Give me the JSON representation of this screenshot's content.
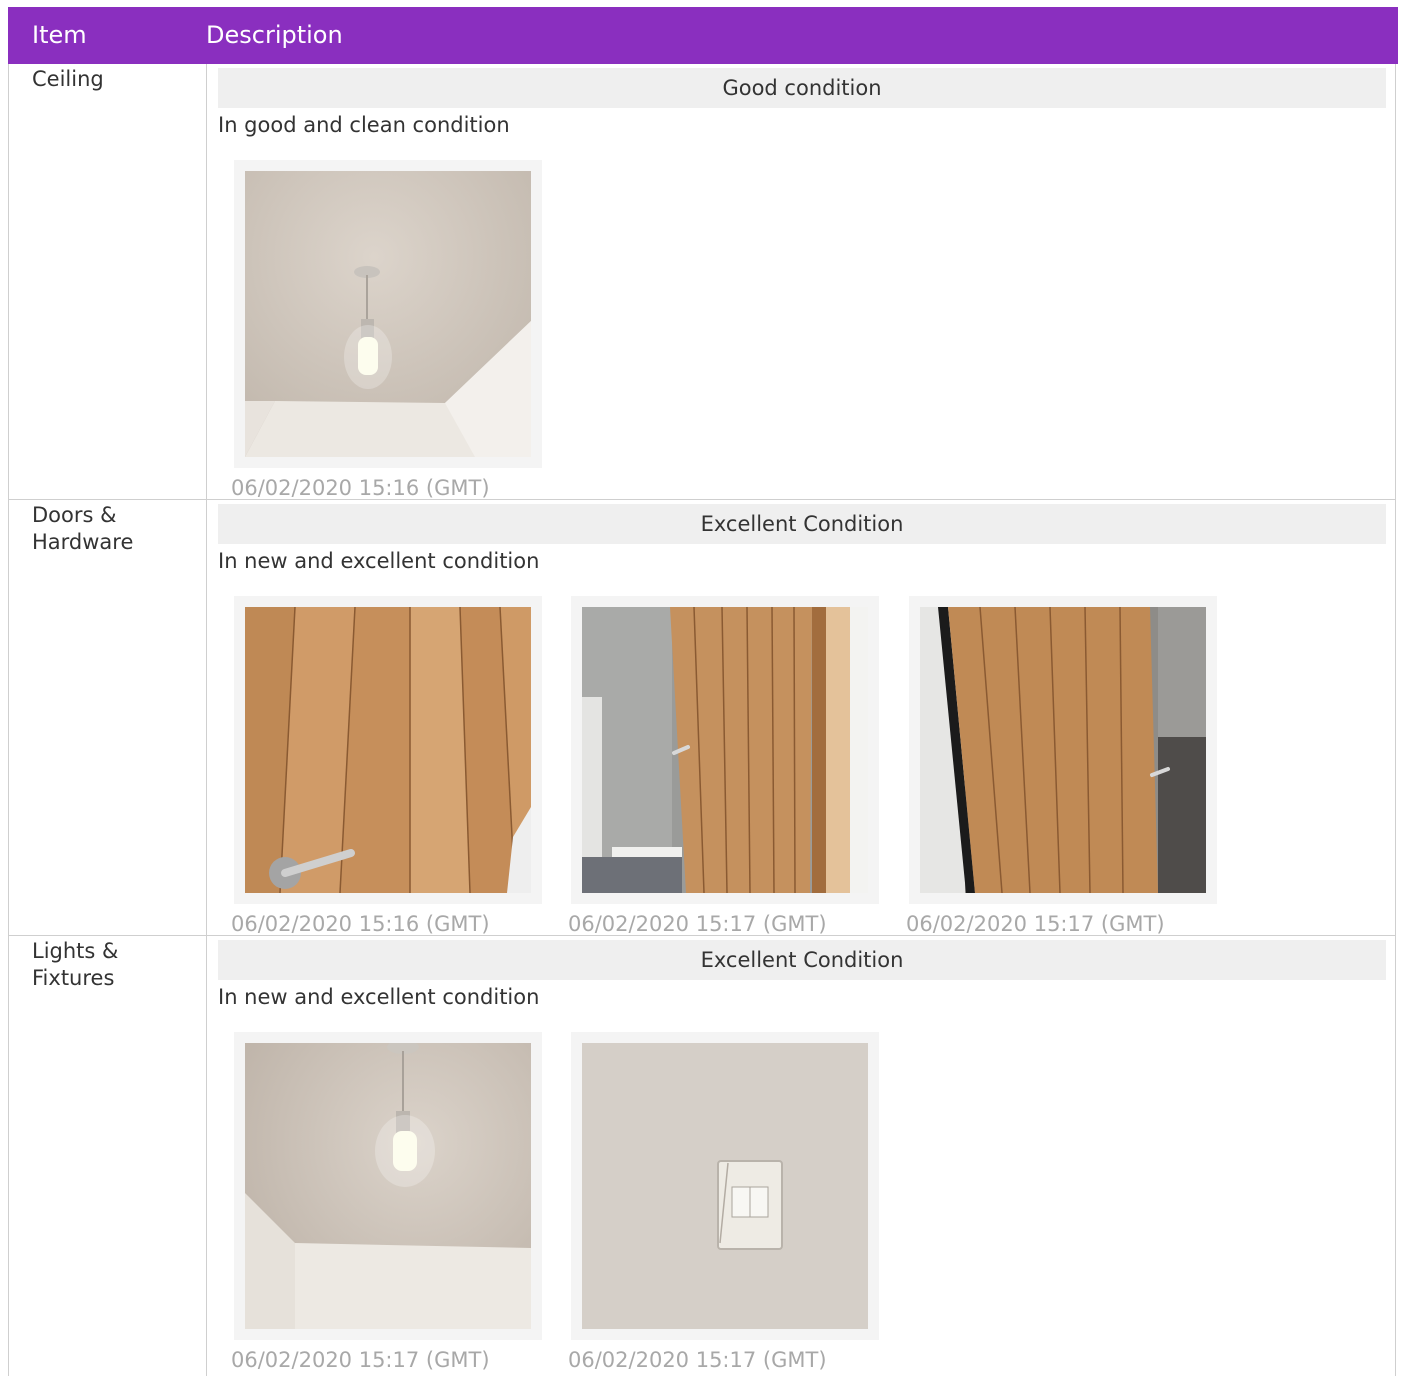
{
  "header": {
    "item": "Item",
    "description": "Description"
  },
  "rows": [
    {
      "item": "Ceiling",
      "condition": "Good condition",
      "description": "In good and clean condition",
      "photos": [
        {
          "subject": "ceiling-light-photo",
          "timestamp": "06/02/2020 15:16 (GMT)"
        }
      ]
    },
    {
      "item": "Doors & Hardware",
      "condition": "Excellent Condition",
      "description": "In new and excellent condition",
      "photos": [
        {
          "subject": "door-handle-photo",
          "timestamp": "06/02/2020 15:16 (GMT)"
        },
        {
          "subject": "door-open-photo",
          "timestamp": "06/02/2020 15:17 (GMT)"
        },
        {
          "subject": "door-edge-photo",
          "timestamp": "06/02/2020 15:17 (GMT)"
        }
      ]
    },
    {
      "item": "Lights & Fixtures",
      "condition": "Excellent Condition",
      "description": "In new and excellent condition",
      "photos": [
        {
          "subject": "ceiling-bulb-photo",
          "timestamp": "06/02/2020 15:17 (GMT)"
        },
        {
          "subject": "light-switch-photo",
          "timestamp": "06/02/2020 15:17 (GMT)"
        }
      ]
    }
  ],
  "colors": {
    "header": "#8a2fbf",
    "condition_bar": "#efefef",
    "border": "#cfcfcf",
    "timestamp": "#a8a8a8"
  }
}
